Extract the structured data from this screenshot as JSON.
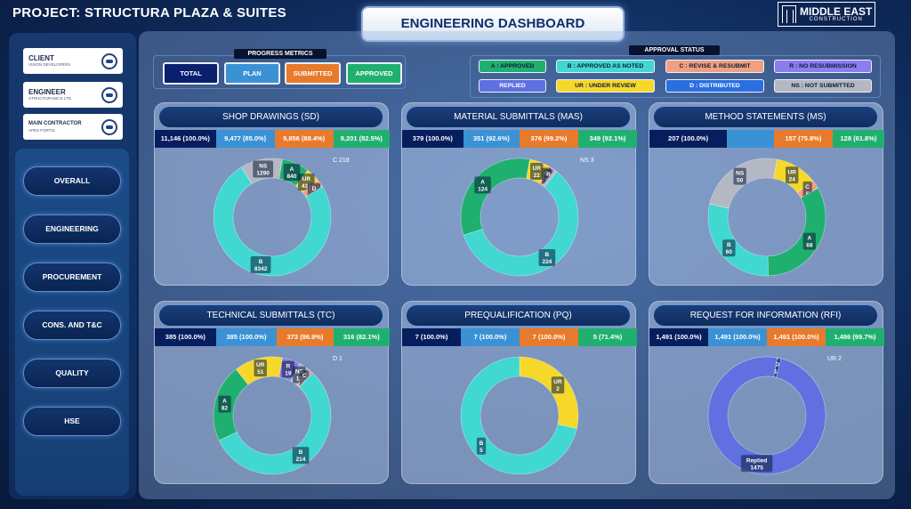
{
  "header": {
    "project_title": "PROJECT: STRUCTURA PLAZA & SUITES",
    "dashboard_title": "ENGINEERING DASHBOARD",
    "logo_line1": "MIDDLE EAST",
    "logo_line2": "CONSTRUCTION"
  },
  "stakeholders": [
    {
      "role": "CLIENT",
      "name": "VISION DEVELOPERS"
    },
    {
      "role": "ENGINEER",
      "name": "STRUCTURANICS LTD."
    },
    {
      "role": "MAIN CONTRACTOR",
      "name": "APEX FORTIS"
    }
  ],
  "nav": [
    "OVERALL",
    "ENGINEERING",
    "PROCUREMENT",
    "CONS. AND T&C",
    "QUALITY",
    "HSE"
  ],
  "progress_metrics": {
    "label": "PROGRESS METRICS",
    "buttons": [
      {
        "label": "TOTAL",
        "color": "#0a1f6e",
        "text": "#ffffff"
      },
      {
        "label": "PLAN",
        "color": "#3a92d4",
        "text": "#ffffff"
      },
      {
        "label": "SUBMITTED",
        "color": "#e87a2b",
        "text": "#ffffff"
      },
      {
        "label": "APPROVED",
        "color": "#1fb06f",
        "text": "#ffffff"
      }
    ]
  },
  "approval_status": {
    "label": "APPROVAL STATUS",
    "items": [
      {
        "label": "A : APPROVED",
        "color": "#1fb06f",
        "text": "#0b1b3a"
      },
      {
        "label": "B : APPROVED AS NOTED",
        "color": "#40d8d0",
        "text": "#0b1b3a"
      },
      {
        "label": "C : REVISE & RESUBMIT",
        "color": "#f0a080",
        "text": "#0b1b3a"
      },
      {
        "label": "R : NO RESUBMISSION",
        "color": "#8b7cf0",
        "text": "#0b1b3a"
      },
      {
        "label": "REPLIED",
        "color": "#6070e0",
        "text": "#ffffff"
      },
      {
        "label": "UR : UNDER REVIEW",
        "color": "#f5d82a",
        "text": "#0b1b3a"
      },
      {
        "label": "D : DISTRIBUTED",
        "color": "#2a6fe0",
        "text": "#ffffff"
      },
      {
        "label": "NS : NOT SUBMITTED",
        "color": "#b4b8c2",
        "text": "#0b1b3a"
      }
    ]
  },
  "colors": {
    "A": "#1fb06f",
    "B": "#40d8d0",
    "C": "#f0a080",
    "R": "#8b7cf0",
    "UR": "#f5d82a",
    "D": "#2a6fe0",
    "NS": "#b4b8c2",
    "Replied": "#6070e0"
  },
  "panels": [
    {
      "title": "SHOP DRAWINGS (SD)",
      "stats": {
        "total": "11,146 (100.0%)",
        "plan": "9,477 (85.0%)",
        "submitted": "9,856 (88.4%)",
        "approved": "9,201 (82.5%)"
      },
      "stat_share": {
        "total": 0.26,
        "plan": 0.25,
        "submitted": 0.25,
        "approved": 0.24
      },
      "segments": [
        {
          "key": "A",
          "value": 840,
          "label": "A\n840"
        },
        {
          "key": "UR",
          "value": 437,
          "label": "UR\n437"
        },
        {
          "key": "C",
          "value": 218,
          "label": ""
        },
        {
          "key": "D",
          "value": 16,
          "label": "D\n16"
        },
        {
          "key": "B",
          "value": 8342,
          "label": "B\n8342"
        },
        {
          "key": "NS",
          "value": 1290,
          "label": "NS\n1290"
        }
      ],
      "outside": [
        {
          "text": "C 218"
        }
      ]
    },
    {
      "title": "MATERIAL SUBMITTALS (MAS)",
      "stats": {
        "total": "379 (100.0%)",
        "plan": "351 (92.6%)",
        "submitted": "376 (99.2%)",
        "approved": "349 (92.1%)"
      },
      "stat_share": {
        "total": 0.26,
        "plan": 0.24,
        "submitted": 0.25,
        "approved": 0.25
      },
      "segments": [
        {
          "key": "UR",
          "value": 22,
          "label": "UR\n22"
        },
        {
          "key": "C",
          "value": 5,
          "label": "C\n5"
        },
        {
          "key": "R",
          "value": 1,
          "label": "R\n1"
        },
        {
          "key": "NS",
          "value": 3,
          "label": ""
        },
        {
          "key": "B",
          "value": 224,
          "label": "B\n224"
        },
        {
          "key": "A",
          "value": 124,
          "label": "A\n124"
        }
      ],
      "outside": [
        {
          "text": "NS 3"
        }
      ]
    },
    {
      "title": "METHOD STATEMENTS (MS)",
      "stats": {
        "total": "207 (100.0%)",
        "plan": "",
        "submitted": "157 (75.8%)",
        "approved": "128 (61.8%)"
      },
      "stat_share": {
        "total": 0.33,
        "plan": 0.2,
        "submitted": 0.25,
        "approved": 0.22
      },
      "segments": [
        {
          "key": "UR",
          "value": 24,
          "label": "UR\n24"
        },
        {
          "key": "C",
          "value": 5,
          "label": "C\n5"
        },
        {
          "key": "A",
          "value": 68,
          "label": "A\n68"
        },
        {
          "key": "B",
          "value": 60,
          "label": "B\n60"
        },
        {
          "key": "NS",
          "value": 50,
          "label": "NS\n50"
        }
      ],
      "outside": []
    },
    {
      "title": "TECHNICAL SUBMITTALS (TC)",
      "stats": {
        "total": "385 (100.0%)",
        "plan": "385 (100.0%)",
        "submitted": "373 (96.9%)",
        "approved": "316 (82.1%)"
      },
      "stat_share": {
        "total": 0.26,
        "plan": 0.26,
        "submitted": 0.24,
        "approved": 0.24
      },
      "segments": [
        {
          "key": "R",
          "value": 19,
          "label": "R\n19"
        },
        {
          "key": "NS",
          "value": 12,
          "label": "NS\n12"
        },
        {
          "key": "C",
          "value": 4,
          "label": "C\n4"
        },
        {
          "key": "D",
          "value": 1,
          "label": ""
        },
        {
          "key": "B",
          "value": 214,
          "label": "B\n214"
        },
        {
          "key": "A",
          "value": 82,
          "label": "A\n82"
        },
        {
          "key": "UR",
          "value": 51,
          "label": "UR\n51"
        }
      ],
      "outside": [
        {
          "text": "D 1"
        }
      ]
    },
    {
      "title": "PREQUALIFICATION (PQ)",
      "stats": {
        "total": "7 (100.0%)",
        "plan": "7 (100.0%)",
        "submitted": "7 (100.0%)",
        "approved": "5 (71.4%)"
      },
      "stat_share": {
        "total": 0.25,
        "plan": 0.25,
        "submitted": 0.25,
        "approved": 0.25
      },
      "segments": [
        {
          "key": "UR",
          "value": 2,
          "label": "UR\n2"
        },
        {
          "key": "B",
          "value": 5,
          "label": "B\n5"
        }
      ],
      "start_deg": -90,
      "outside": []
    },
    {
      "title": "REQUEST FOR INFORMATION (RFI)",
      "stats": {
        "total": "1,491 (100.0%)",
        "plan": "1,491 (100.0%)",
        "submitted": "1,491 (100.0%)",
        "approved": "1,486 (99.7%)"
      },
      "stat_share": {
        "total": 0.25,
        "plan": 0.25,
        "submitted": 0.25,
        "approved": 0.25
      },
      "segments": [
        {
          "key": "UR",
          "value": 2,
          "label": ""
        },
        {
          "key": "D",
          "value": 14,
          "label": "D\n14"
        },
        {
          "key": "Replied",
          "value": 1475,
          "label": "Replied\n1475"
        }
      ],
      "outside": [
        {
          "text": "UR 2"
        }
      ]
    }
  ]
}
